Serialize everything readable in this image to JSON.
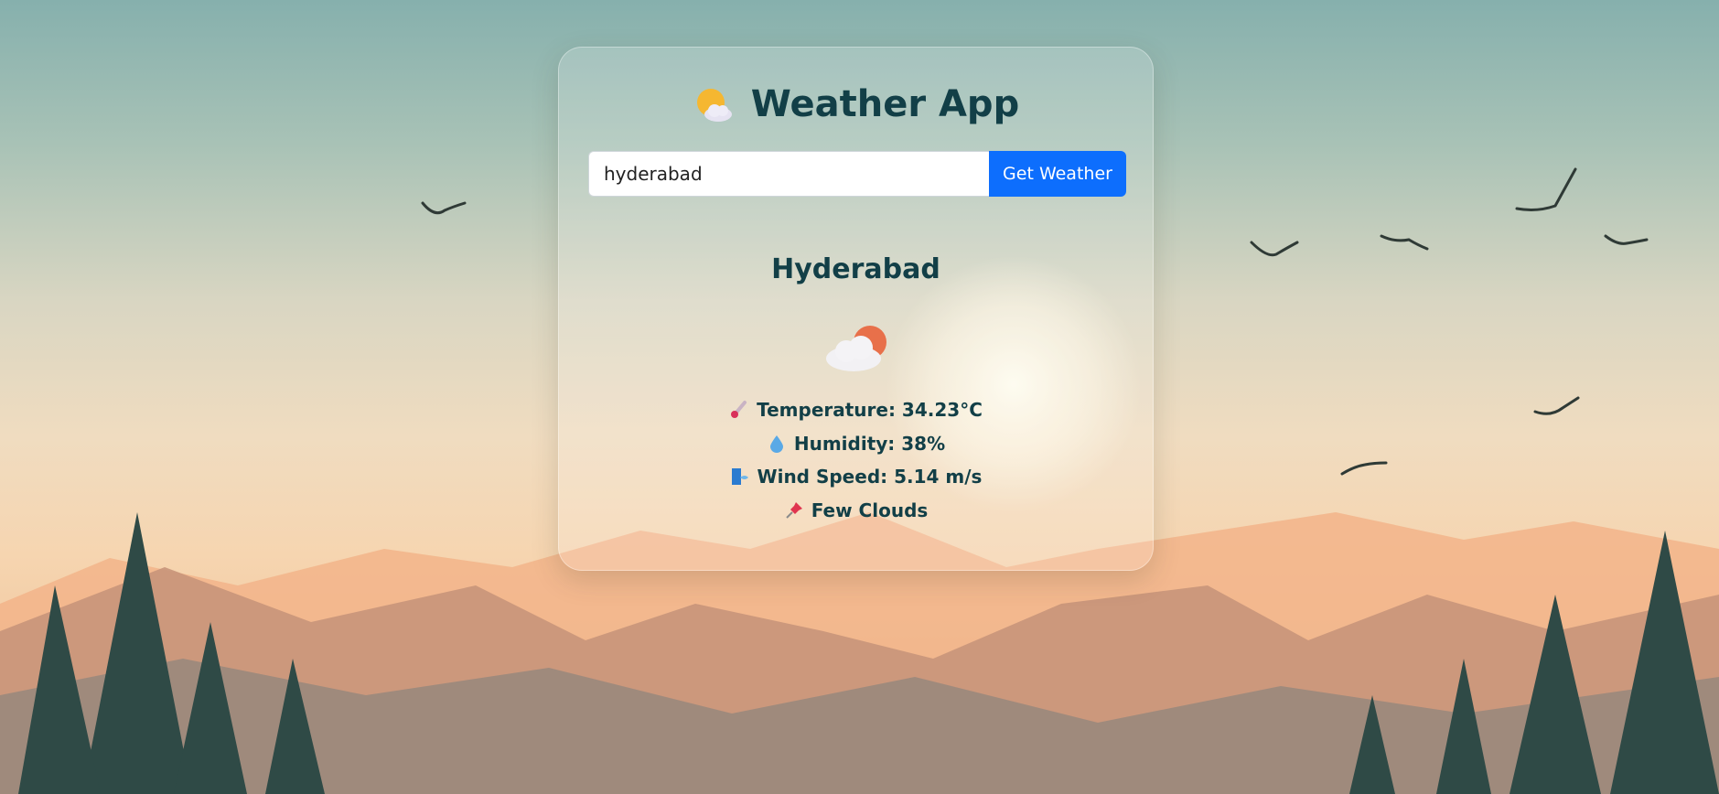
{
  "app": {
    "title": "Weather App",
    "title_icon": "sun-behind-cloud-icon"
  },
  "search": {
    "value": "hyderabad",
    "button_label": "Get Weather"
  },
  "result": {
    "city": "Hyderabad",
    "condition_icon": "partly-cloudy-icon",
    "temperature": "Temperature: 34.23°C",
    "humidity": "Humidity: 38%",
    "wind_speed": "Wind Speed: 5.14 m/s",
    "description": "Few Clouds"
  },
  "colors": {
    "accent": "#0d6efd",
    "text": "#123f47"
  }
}
